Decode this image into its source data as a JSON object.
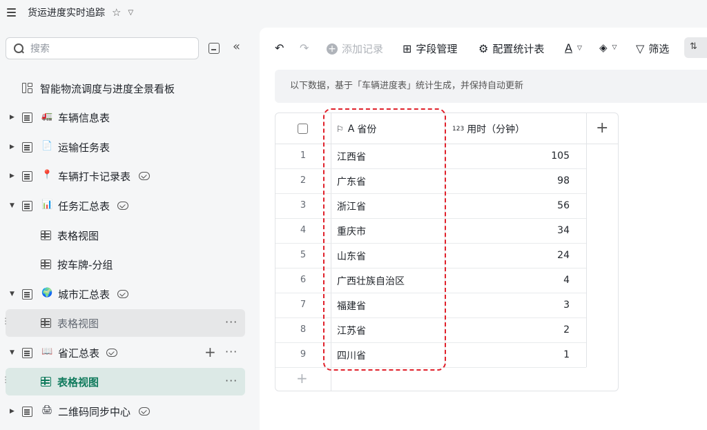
{
  "header": {
    "title": "货运进度实时追踪"
  },
  "sidebar": {
    "search_placeholder": "搜索",
    "dashboard": {
      "label": "智能物流调度与进度全景看板"
    },
    "items": [
      {
        "label": "车辆信息表",
        "emoji": "🚛"
      },
      {
        "label": "运输任务表",
        "emoji": "📄"
      },
      {
        "label": "车辆打卡记录表",
        "emoji": "📍"
      },
      {
        "label": "任务汇总表",
        "emoji": "📊"
      },
      {
        "label": "表格视图"
      },
      {
        "label": "按车牌-分组"
      },
      {
        "label": "城市汇总表",
        "emoji": "🌍"
      },
      {
        "label": "表格视图"
      },
      {
        "label": "省汇总表",
        "emoji": "📖"
      },
      {
        "label": "表格视图"
      },
      {
        "label": "二维码同步中心",
        "emoji": "🖨"
      }
    ]
  },
  "toolbar": {
    "add_record": "添加记录",
    "field_manage": "字段管理",
    "config_stats": "配置统计表",
    "filter": "筛选"
  },
  "notice": "以下数据，基于「车辆进度表」统计生成，并保持自动更新",
  "table": {
    "columns": {
      "province": "省份",
      "time": "用时（分钟）",
      "time_prefix": "123"
    },
    "rows": [
      {
        "num": "1",
        "province": "江西省",
        "time": "105"
      },
      {
        "num": "2",
        "province": "广东省",
        "time": "98"
      },
      {
        "num": "3",
        "province": "浙江省",
        "time": "56"
      },
      {
        "num": "4",
        "province": "重庆市",
        "time": "34"
      },
      {
        "num": "5",
        "province": "山东省",
        "time": "24"
      },
      {
        "num": "6",
        "province": "广西壮族自治区",
        "time": "4"
      },
      {
        "num": "7",
        "province": "福建省",
        "time": "3"
      },
      {
        "num": "8",
        "province": "江苏省",
        "time": "2"
      },
      {
        "num": "9",
        "province": "四川省",
        "time": "1"
      }
    ]
  },
  "colors": {
    "accent": "#0f7a5c",
    "highlight": "#e0202a"
  }
}
